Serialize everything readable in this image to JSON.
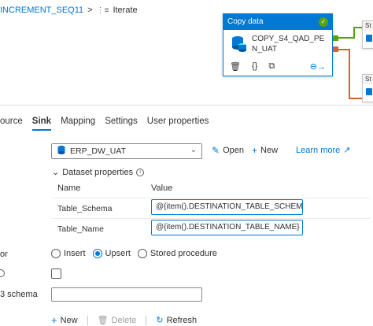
{
  "breadcrumb": {
    "pipeline": "INCREMENT_SEQ11",
    "separator": ">",
    "current": "Iterate"
  },
  "activity": {
    "type": "Copy data",
    "name": "COPY_S4_QAD_PEN_UAT",
    "status_icon": "check-circle-icon",
    "tools": [
      "delete-icon",
      "code-icon",
      "copy-icon",
      "run-arrow-icon"
    ]
  },
  "side_cards": [
    {
      "label": "St"
    },
    {
      "label": "St"
    }
  ],
  "tabs": [
    {
      "label": "ource"
    },
    {
      "label": "Sink",
      "active": true
    },
    {
      "label": "Mapping"
    },
    {
      "label": "Settings"
    },
    {
      "label": "User properties"
    }
  ],
  "sink": {
    "dataset": "ERP_DW_UAT",
    "open_label": "Open",
    "new_label": "New",
    "learn_more_label": "Learn more",
    "dataset_properties_label": "Dataset properties",
    "grid": {
      "headers": [
        "Name",
        "Value"
      ],
      "rows": [
        {
          "name": "Table_Schema",
          "value": "@{item().DESTINATION_TABLE_SCHEM..."
        },
        {
          "name": "Table_Name",
          "value": "@{item().DESTINATION_TABLE_NAME}"
        }
      ]
    },
    "write_behavior_label": "or",
    "write_behavior_options": [
      "Insert",
      "Upsert",
      "Stored procedure"
    ],
    "write_behavior_selected": "Upsert",
    "schema_label": "3 schema",
    "schema_value": "",
    "bottom_actions": {
      "new": "New",
      "delete": "Delete",
      "refresh": "Refresh"
    }
  },
  "colors": {
    "accent": "#0078d4",
    "success": "#57a300",
    "failure": "#d6603a"
  }
}
